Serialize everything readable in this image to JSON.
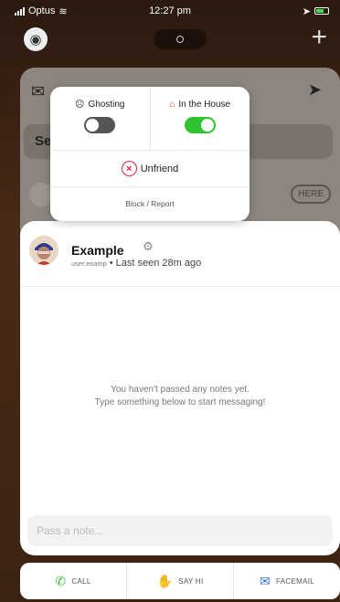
{
  "status_bar": {
    "carrier": "Optus",
    "time": "12:27 pm"
  },
  "back_card": {
    "search_partial": "Se",
    "here_badge": "HERE"
  },
  "popover": {
    "ghosting_label": "Ghosting",
    "ghosting_on": false,
    "in_house_label": "In the House",
    "in_house_on": true,
    "unfriend_label": "Unfriend",
    "block_report_label": "Block / Report"
  },
  "chat": {
    "name": "Example",
    "username": "user.examp",
    "separator": "•",
    "last_seen": "Last seen 28m ago",
    "empty_line1": "You haven't passed any notes yet.",
    "empty_line2": "Type something below to start messaging!",
    "input_placeholder": "Pass a note..."
  },
  "actions": {
    "call": "CALL",
    "say_hi": "SAY HI",
    "facemail": "FACEMAIL"
  },
  "colors": {
    "toggle_on": "#2fc42f",
    "unfriend_red": "#e0243a",
    "call_green": "#2fc42f",
    "facemail_blue": "#2d6fe0"
  }
}
